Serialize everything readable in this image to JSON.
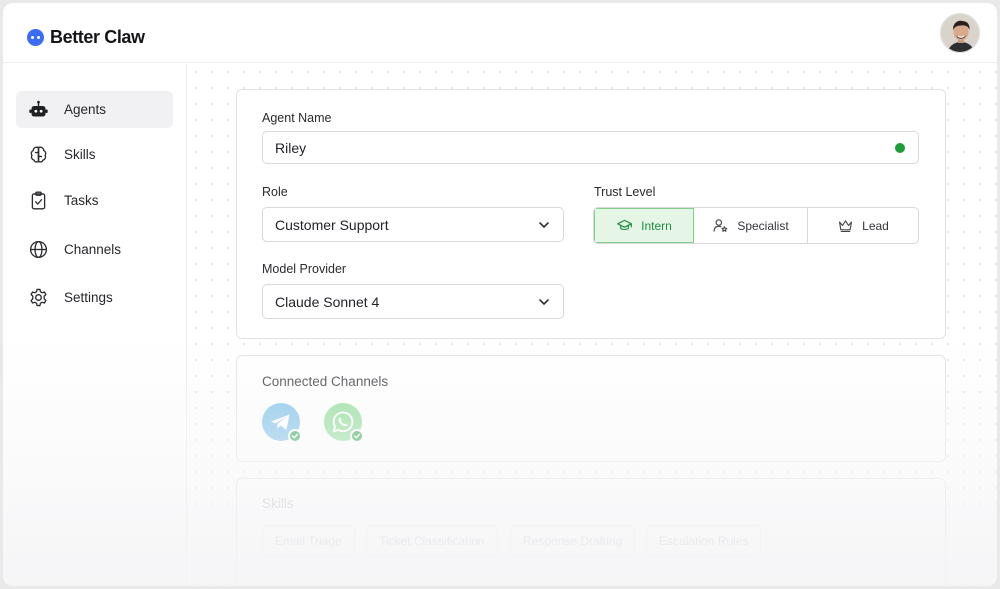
{
  "app": {
    "name": "Better Claw"
  },
  "sidebar": {
    "items": [
      {
        "label": "Agents",
        "icon": "robot-icon",
        "active": true
      },
      {
        "label": "Skills",
        "icon": "brain-icon"
      },
      {
        "label": "Tasks",
        "icon": "clipboard-check-icon"
      },
      {
        "label": "Channels",
        "icon": "globe-icon"
      },
      {
        "label": "Settings",
        "icon": "gear-icon"
      }
    ]
  },
  "form": {
    "agent_name_label": "Agent Name",
    "agent_name_value": "Riley",
    "role_label": "Role",
    "role_value": "Customer Support",
    "trust_label": "Trust Level",
    "trust_options": [
      {
        "label": "Intern",
        "icon": "graduation-cap-icon",
        "selected": true
      },
      {
        "label": "Specialist",
        "icon": "user-star-icon"
      },
      {
        "label": "Lead",
        "icon": "crown-icon"
      }
    ],
    "model_label": "Model Provider",
    "model_value": "Claude Sonnet 4"
  },
  "channels": {
    "title": "Connected Channels",
    "items": [
      {
        "name": "telegram",
        "icon": "telegram-icon",
        "color": "#2aa3e0",
        "connected": true
      },
      {
        "name": "whatsapp",
        "icon": "whatsapp-icon",
        "color": "#25d366",
        "connected": true
      }
    ]
  },
  "skills": {
    "title": "Skills",
    "items": [
      "Email Triage",
      "Ticket Classification",
      "Response Drafting",
      "Escalation Rules"
    ]
  },
  "colors": {
    "brand": "#3b6cf6",
    "accent_green": "#1e8e3e",
    "status_online": "#1f9d3a"
  }
}
